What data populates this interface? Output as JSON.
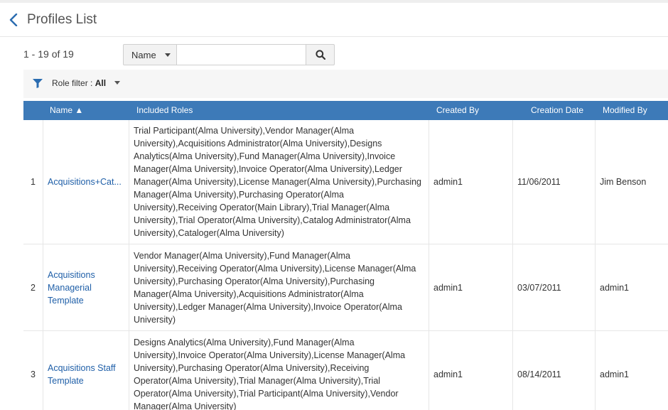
{
  "header": {
    "title": "Profiles List"
  },
  "results": {
    "count": "1 - 19 of 19"
  },
  "search": {
    "scope": "Name",
    "value": "",
    "placeholder": ""
  },
  "filter": {
    "label": "Role filter : ",
    "value": "All"
  },
  "table": {
    "columns": {
      "name": "Name ▲",
      "roles": "Included Roles",
      "created_by": "Created By",
      "creation_date": "Creation Date",
      "modified_by": "Modified By"
    },
    "rows": [
      {
        "num": "1",
        "name": "Acquisitions+Cat...",
        "roles": "Trial Participant(Alma University),Vendor Manager(Alma University),Acquisitions Administrator(Alma University),Designs Analytics(Alma University),Fund Manager(Alma University),Invoice Manager(Alma University),Invoice Operator(Alma University),Ledger Manager(Alma University),License Manager(Alma University),Purchasing Manager(Alma University),Purchasing Operator(Alma University),Receiving Operator(Main Library),Trial Manager(Alma University),Trial Operator(Alma University),Catalog Administrator(Alma University),Cataloger(Alma University)",
        "created_by": "admin1",
        "creation_date": "11/06/2011",
        "modified_by": "Jim Benson"
      },
      {
        "num": "2",
        "name": "Acquisitions Managerial Template",
        "roles": "Vendor Manager(Alma University),Fund Manager(Alma University),Receiving Operator(Alma University),License Manager(Alma University),Purchasing Operator(Alma University),Purchasing Manager(Alma University),Acquisitions Administrator(Alma University),Ledger Manager(Alma University),Invoice Operator(Alma University)",
        "created_by": "admin1",
        "creation_date": "03/07/2011",
        "modified_by": "admin1"
      },
      {
        "num": "3",
        "name": "Acquisitions Staff Template",
        "roles": "Designs Analytics(Alma University),Fund Manager(Alma University),Invoice Operator(Alma University),License Manager(Alma University),Purchasing Operator(Alma University),Receiving Operator(Alma University),Trial Manager(Alma University),Trial Operator(Alma University),Trial Participant(Alma University),Vendor Manager(Alma University)",
        "created_by": "admin1",
        "creation_date": "08/14/2011",
        "modified_by": "admin1"
      }
    ]
  },
  "colors": {
    "header_bg": "#3d7ab8",
    "link": "#1f5fa8",
    "accent_icon": "#2a6cb0"
  },
  "icons": {
    "back": "chevron-left-icon",
    "search": "search-icon",
    "filter": "filter-funnel-icon",
    "caret": "caret-down-icon"
  }
}
